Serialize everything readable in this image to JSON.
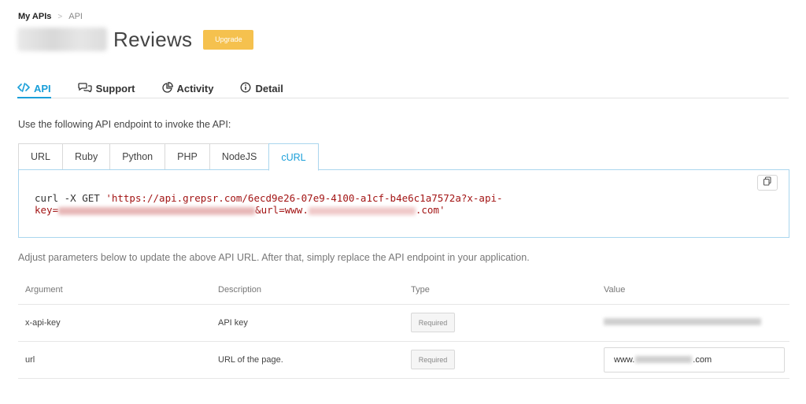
{
  "breadcrumb": {
    "root": "My APIs",
    "separator": ">",
    "current": "API"
  },
  "header": {
    "title": "Reviews",
    "upgrade_label": "Upgrade"
  },
  "main_tabs": [
    {
      "label": "API",
      "icon": "code-icon",
      "active": true
    },
    {
      "label": "Support",
      "icon": "chat-bubbles-icon",
      "active": false
    },
    {
      "label": "Activity",
      "icon": "pie-chart-icon",
      "active": false
    },
    {
      "label": "Detail",
      "icon": "info-circle-icon",
      "active": false
    }
  ],
  "intro_text": "Use the following API endpoint to invoke the API:",
  "lang_tabs": [
    "URL",
    "Ruby",
    "Python",
    "PHP",
    "NodeJS",
    "cURL"
  ],
  "active_lang": "cURL",
  "code": {
    "prefix": "curl -X GET ",
    "url_line1": "'https://api.grepsr.com/6ecd9e26-07e9-4100-a1cf-b4e6c1a7572a?x-api-",
    "key_label": "key=",
    "url_mid": "&url=www.",
    "url_end": ".com'"
  },
  "adjust_text": "Adjust parameters below to update the above API URL. After that, simply replace the API endpoint in your application.",
  "params_table": {
    "headers": [
      "Argument",
      "Description",
      "Type",
      "Value"
    ],
    "rows": [
      {
        "argument": "x-api-key",
        "description": "API key",
        "type": "Required"
      },
      {
        "argument": "url",
        "description": "URL of the page.",
        "type": "Required",
        "value_prefix": "www.",
        "value_suffix": ".com"
      }
    ]
  },
  "colors": {
    "accent": "#1a9fd9",
    "upgrade": "#f5c14e",
    "code_string": "#a31515"
  }
}
